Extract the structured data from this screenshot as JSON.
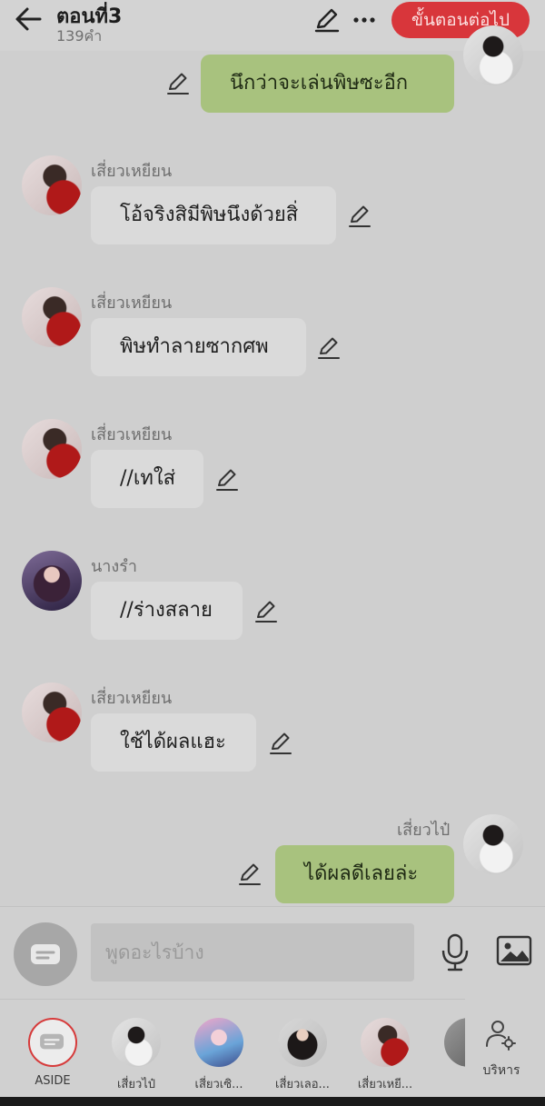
{
  "header": {
    "title": "ตอนที่3",
    "word_count": "139คำ",
    "next_button": "ขั้นตอนต่อไป",
    "icons": [
      "back-arrow-icon",
      "pencil-icon",
      "more-dots-icon"
    ]
  },
  "messages": [
    {
      "side": "right",
      "sender": "",
      "text": "นึกว่าจะเล่นพิษซะอีก",
      "avatar": "xiaopai"
    },
    {
      "side": "left",
      "sender": "เสี่ยวเหยียน",
      "text": "โอ้จริงสิมีพิษนึงด้วยสิ่",
      "avatar": "xiaoyan"
    },
    {
      "side": "left",
      "sender": "เสี่ยวเหยียน",
      "text": "พิษทำลายซากศพ",
      "avatar": "xiaoyan"
    },
    {
      "side": "left",
      "sender": "เสี่ยวเหยียน",
      "text": "//เทใส่",
      "avatar": "xiaoyan"
    },
    {
      "side": "left",
      "sender": "นางรำ",
      "text": "//ร่างสลาย",
      "avatar": "nangram"
    },
    {
      "side": "left",
      "sender": "เสี่ยวเหยียน",
      "text": "ใช้ได้ผลแฮะ",
      "avatar": "xiaoyan"
    },
    {
      "side": "right",
      "sender": "เสี่ยวไป๋",
      "text": "ได้ผลดีเลยล่ะ",
      "avatar": "xiaopai"
    }
  ],
  "input": {
    "placeholder": "พูดอะไรบ้าง",
    "icons": [
      "chat-bubble-icon",
      "microphone-icon",
      "image-icon"
    ]
  },
  "characters": [
    {
      "label": "ASIDE",
      "avatar": "aside"
    },
    {
      "label": "เสี่ยวไป๋",
      "avatar": "xiaopai"
    },
    {
      "label": "เสี่ยวเซิ...",
      "avatar": "xiaoshi"
    },
    {
      "label": "เสี่ยวเลอ...",
      "avatar": "xiaolao"
    },
    {
      "label": "เสี่ยวเหยี...",
      "avatar": "xiaoyan"
    },
    {
      "label": "",
      "avatar": "grey"
    }
  ],
  "manage": {
    "label": "บริหาร",
    "icon": "user-settings-icon"
  },
  "colors": {
    "accent_red": "#d8363b",
    "right_bubble": "#a8c27e",
    "left_bubble": "#dadada",
    "background": "#cfcfcf"
  }
}
